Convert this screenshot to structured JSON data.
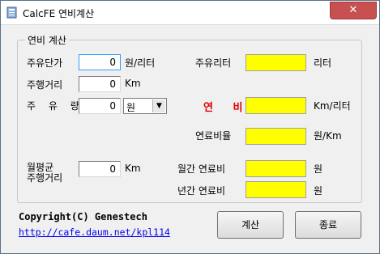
{
  "window": {
    "title": "CalcFE 연비계산",
    "close_label": "✕"
  },
  "group": {
    "label": "연비 계산"
  },
  "fields": {
    "fuel_price": {
      "label": "주유단가",
      "value": "0",
      "unit": "원/리터"
    },
    "distance": {
      "label": "주행거리",
      "value": "0",
      "unit": "Km"
    },
    "fuel_amount": {
      "label": "주 유 량",
      "value": "0",
      "unit_selected": "원"
    },
    "monthly_distance": {
      "label_line1": "월평균",
      "label_line2": "주행거리",
      "value": "0",
      "unit": "Km"
    }
  },
  "results": {
    "fuel_liters": {
      "label": "주유리터",
      "unit": "리터"
    },
    "efficiency": {
      "label": "연 비",
      "unit": "Km/리터",
      "label_color": "#e00000"
    },
    "fuel_ratio": {
      "label": "연료비율",
      "unit": "원/Km"
    },
    "monthly_cost": {
      "label": "월간 연료비",
      "unit": "원"
    },
    "yearly_cost": {
      "label": "년간 연료비",
      "unit": "원"
    }
  },
  "footer": {
    "copyright": "Copyright(C) Genestech",
    "link": "http://cafe.daum.net/kpl114"
  },
  "buttons": {
    "calculate": "계산",
    "exit": "종료"
  },
  "colors": {
    "result_bg": "#ffff00",
    "accent_red": "#e00000",
    "link": "#0000ee"
  }
}
